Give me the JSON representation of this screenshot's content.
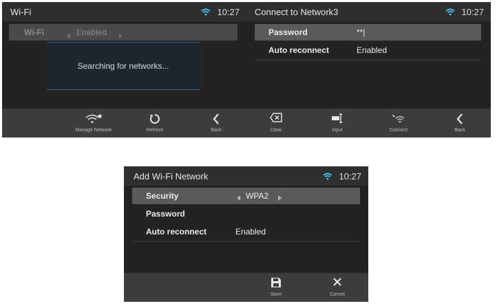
{
  "screen1": {
    "title": "Wi-Fi",
    "time": "10:27",
    "wifi_row": {
      "label": "Wi-Fi",
      "value": "Enabled"
    },
    "dialog_text": "Searching for networks...",
    "toolbar": [
      {
        "label": "Manage Network",
        "icon": "wifi-settings-icon"
      },
      {
        "label": "Refresh",
        "icon": "refresh-icon"
      },
      {
        "label": "Back",
        "icon": "back-chevron-icon"
      }
    ]
  },
  "screen2": {
    "title": "Connect to Network3",
    "time": "10:27",
    "rows": [
      {
        "label": "Password",
        "value": "**|"
      },
      {
        "label": "Auto reconnect",
        "value": "Enabled"
      }
    ],
    "toolbar": [
      {
        "label": "Clear",
        "icon": "clear-icon"
      },
      {
        "label": "Input",
        "icon": "input-icon"
      },
      {
        "label": "Connect",
        "icon": "connect-icon"
      },
      {
        "label": "Back",
        "icon": "back-chevron-icon"
      }
    ]
  },
  "screen3": {
    "title": "Add Wi-Fi Network",
    "time": "10:27",
    "rows": [
      {
        "label": "Security",
        "value": "WPA2"
      },
      {
        "label": "Password",
        "value": ""
      },
      {
        "label": "Auto reconnect",
        "value": "Enabled"
      }
    ],
    "toolbar": [
      {
        "label": "Save",
        "icon": "save-icon"
      },
      {
        "label": "Cancel",
        "icon": "cancel-icon"
      }
    ]
  },
  "colors": {
    "screen_bg": "#262626",
    "selected_row": "#5a5a5a",
    "toolbar_bg": "#3d3d3d",
    "dialog_border": "#3a5d78"
  }
}
